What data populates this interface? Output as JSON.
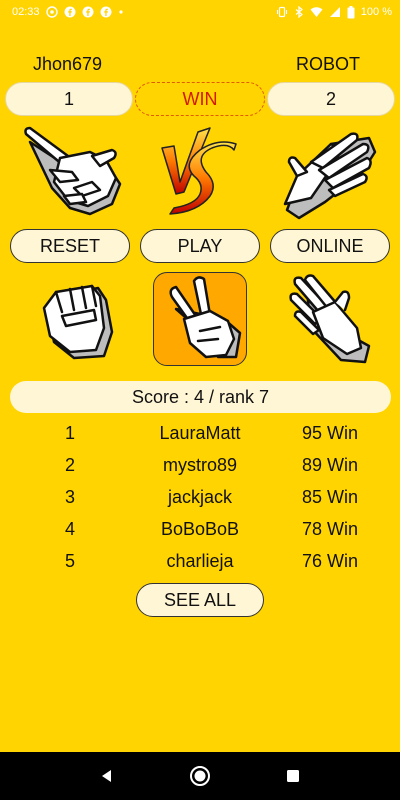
{
  "status_bar": {
    "time": "02:33",
    "battery": "100 %",
    "icons_left": [
      "whatsapp-icon",
      "facebook-icon",
      "facebook-icon",
      "facebook-icon",
      "dot-icon"
    ],
    "icons_right": [
      "vibrate-icon",
      "bluetooth-icon",
      "wifi-icon",
      "signal-icon",
      "battery-icon"
    ]
  },
  "players": {
    "left_name": "Jhon679",
    "right_name": "ROBOT",
    "left_score": "1",
    "right_score": "2",
    "result": "WIN"
  },
  "hands": {
    "player_choice": "scissors-hand-icon",
    "robot_choice": "paper-hand-icon",
    "vs_logo": "vs-logo"
  },
  "buttons": {
    "reset": "RESET",
    "play": "PLAY",
    "online": "ONLINE",
    "see_all": "SEE ALL"
  },
  "choices": [
    {
      "name": "rock",
      "icon": "rock-hand-icon",
      "selected": false
    },
    {
      "name": "scissors",
      "icon": "scissors-hand-icon",
      "selected": true
    },
    {
      "name": "paper",
      "icon": "paper-hand-icon",
      "selected": false
    }
  ],
  "score_summary": "Score : 4 / rank 7",
  "leaderboard": [
    {
      "rank": "1",
      "name": "LauraMatt",
      "wins": "95 Win"
    },
    {
      "rank": "2",
      "name": "mystro89",
      "wins": "89 Win"
    },
    {
      "rank": "3",
      "name": "jackjack",
      "wins": "85 Win"
    },
    {
      "rank": "4",
      "name": "BoBoBoB",
      "wins": "78 Win"
    },
    {
      "rank": "5",
      "name": "charlieja",
      "wins": "76 Win"
    }
  ],
  "colors": {
    "background": "#FFD400",
    "pill": "#FFF6D6",
    "selected_choice": "#FFA800",
    "win_text": "#D21A00"
  }
}
